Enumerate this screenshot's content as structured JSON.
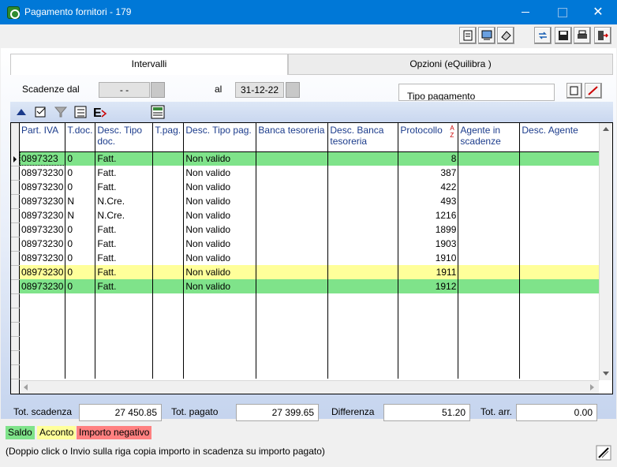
{
  "window": {
    "title": "Pagamento fornitori - 179"
  },
  "tabs": [
    {
      "label": "Intervalli",
      "active": true
    },
    {
      "label": "Opzioni (eQuilibra )",
      "active": false
    }
  ],
  "filters": {
    "scadenze_dal_label": "Scadenze dal",
    "scadenze_dal_value": "- -",
    "al_label": "al",
    "al_value": "31-12-22",
    "tipo_pagamento_label": "Tipo pagamento"
  },
  "grid": {
    "columns": [
      "Part. IVA",
      "T.doc.",
      "Desc. Tipo doc.",
      "T.pag.",
      "Desc. Tipo pag.",
      "Banca tesoreria",
      "Desc. Banca tesoreria",
      "Protocollo",
      "Agente in scadenze",
      "Desc. Agente"
    ],
    "sort_indicator": "AZ",
    "rows": [
      {
        "piva": "0897323",
        "tdoc": "0",
        "desc_tdoc": "Fatt.",
        "tpag": "",
        "desc_tpag": "Non valido",
        "banca": "",
        "desc_banca": "",
        "protocollo": "8",
        "agente": "",
        "desc_agente": "",
        "color": "green"
      },
      {
        "piva": "08973230",
        "tdoc": "0",
        "desc_tdoc": "Fatt.",
        "tpag": "",
        "desc_tpag": "Non valido",
        "banca": "",
        "desc_banca": "",
        "protocollo": "387",
        "agente": "",
        "desc_agente": "",
        "color": ""
      },
      {
        "piva": "08973230",
        "tdoc": "0",
        "desc_tdoc": "Fatt.",
        "tpag": "",
        "desc_tpag": "Non valido",
        "banca": "",
        "desc_banca": "",
        "protocollo": "422",
        "agente": "",
        "desc_agente": "",
        "color": ""
      },
      {
        "piva": "08973230",
        "tdoc": "N",
        "desc_tdoc": "N.Cre.",
        "tpag": "",
        "desc_tpag": "Non valido",
        "banca": "",
        "desc_banca": "",
        "protocollo": "493",
        "agente": "",
        "desc_agente": "",
        "color": ""
      },
      {
        "piva": "08973230",
        "tdoc": "N",
        "desc_tdoc": "N.Cre.",
        "tpag": "",
        "desc_tpag": "Non valido",
        "banca": "",
        "desc_banca": "",
        "protocollo": "1216",
        "agente": "",
        "desc_agente": "",
        "color": ""
      },
      {
        "piva": "08973230",
        "tdoc": "0",
        "desc_tdoc": "Fatt.",
        "tpag": "",
        "desc_tpag": "Non valido",
        "banca": "",
        "desc_banca": "",
        "protocollo": "1899",
        "agente": "",
        "desc_agente": "",
        "color": ""
      },
      {
        "piva": "08973230",
        "tdoc": "0",
        "desc_tdoc": "Fatt.",
        "tpag": "",
        "desc_tpag": "Non valido",
        "banca": "",
        "desc_banca": "",
        "protocollo": "1903",
        "agente": "",
        "desc_agente": "",
        "color": ""
      },
      {
        "piva": "08973230",
        "tdoc": "0",
        "desc_tdoc": "Fatt.",
        "tpag": "",
        "desc_tpag": "Non valido",
        "banca": "",
        "desc_banca": "",
        "protocollo": "1910",
        "agente": "",
        "desc_agente": "",
        "color": ""
      },
      {
        "piva": "08973230",
        "tdoc": "0",
        "desc_tdoc": "Fatt.",
        "tpag": "",
        "desc_tpag": "Non valido",
        "banca": "",
        "desc_banca": "",
        "protocollo": "1911",
        "agente": "",
        "desc_agente": "",
        "color": "yellow"
      },
      {
        "piva": "08973230",
        "tdoc": "0",
        "desc_tdoc": "Fatt.",
        "tpag": "",
        "desc_tpag": "Non valido",
        "banca": "",
        "desc_banca": "",
        "protocollo": "1912",
        "agente": "",
        "desc_agente": "",
        "color": "green"
      }
    ]
  },
  "totals": {
    "tot_scadenza_label": "Tot. scadenza",
    "tot_scadenza_value": "27 450.85",
    "tot_pagato_label": "Tot. pagato",
    "tot_pagato_value": "27 399.65",
    "differenza_label": "Differenza",
    "differenza_value": "51.20",
    "tot_arr_label": "Tot. arr.",
    "tot_arr_value": "0.00"
  },
  "legend": [
    {
      "label": "Saldo",
      "color": "#7fe38a"
    },
    {
      "label": "Acconto",
      "color": "#ffff9a"
    },
    {
      "label": "Importo negativo",
      "color": "#ff8080"
    }
  ],
  "hint": "(Doppio click o Invio sulla riga copia importo in scadenza su importo pagato)",
  "colors": {
    "titlebar": "#0078d7",
    "row_green": "#7fe38a",
    "row_yellow": "#ffff9a"
  }
}
